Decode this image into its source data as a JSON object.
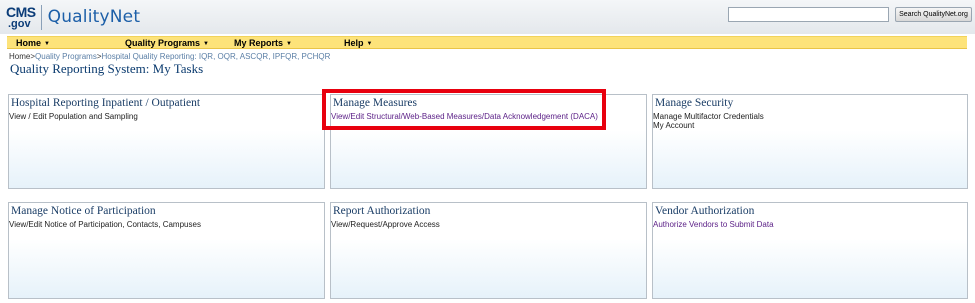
{
  "header": {
    "logo": {
      "cms": "CMS",
      "gov": ".gov",
      "name": "QualityNet"
    },
    "search": {
      "value": "",
      "placeholder": "",
      "button_label": "Search QualityNet.org"
    }
  },
  "nav": [
    {
      "label": "Home"
    },
    {
      "label": "Quality Programs"
    },
    {
      "label": "My Reports"
    },
    {
      "label": "Help"
    }
  ],
  "breadcrumb": {
    "home": "Home",
    "sep1": ">",
    "quality_programs": "Quality Programs",
    "sep2": ">",
    "current": "Hospital Quality Reporting: IQR, OQR, ASCQR, IPFQR, PCHQR"
  },
  "page_title": "Quality Reporting System: My Tasks",
  "cards": [
    {
      "title": "Hospital Reporting Inpatient / Outpatient",
      "links": [
        "View / Edit Population and Sampling"
      ]
    },
    {
      "title": "Manage Measures",
      "links": [
        "View/Edit Structural/Web-Based Measures/Data Acknowledgement (DACA)"
      ]
    },
    {
      "title": "Manage Security",
      "links": [
        "Manage Multifactor Credentials",
        "My Account"
      ]
    },
    {
      "title": "Manage Notice of Participation",
      "links": [
        "View/Edit Notice of Participation, Contacts, Campuses"
      ]
    },
    {
      "title": "Report Authorization",
      "links": [
        "View/Request/Approve Access"
      ]
    },
    {
      "title": "Vendor Authorization",
      "links": [
        "Authorize Vendors to Submit Data"
      ]
    }
  ],
  "colors": {
    "nav_background": "#fde37a",
    "highlight_border": "#e8000e",
    "title_color": "#0b3b6f",
    "visited_link": "#5a1e86"
  }
}
